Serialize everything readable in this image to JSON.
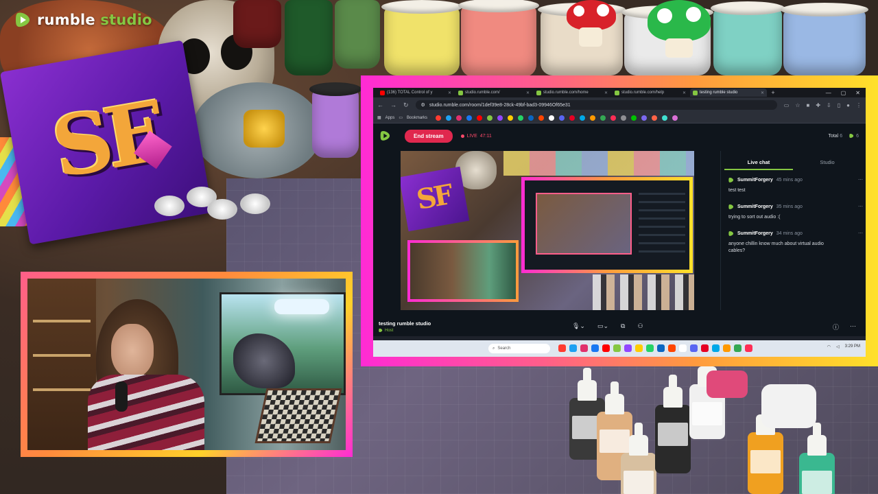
{
  "brand": {
    "name_main": "rumble",
    "name_accent": " studio",
    "accent_color": "#85c742"
  },
  "background": {
    "sf_letters": "SF"
  },
  "browser": {
    "tabs": [
      {
        "label": "(136) TOTAL Control of y",
        "favicon_color": "#ff0000"
      },
      {
        "label": "studio.rumble.com/",
        "favicon_color": "#85c742"
      },
      {
        "label": "studio.rumble.com/home",
        "favicon_color": "#85c742"
      },
      {
        "label": "studio.rumble.com/help",
        "favicon_color": "#85c742"
      },
      {
        "label": "testing rumble studio",
        "favicon_color": "#85c742"
      }
    ],
    "new_tab": "+",
    "url": "studio.rumble.com/room/1def39e8-28ck-49bf-bad3-09946Of65e31",
    "bookmarks_label": "Bookmarks",
    "apps_label": "Apps",
    "bookmark_colors": [
      "#ff3b30",
      "#1da1f2",
      "#e1306c",
      "#1877f2",
      "#ff0000",
      "#85c742",
      "#9146ff",
      "#ffcc00",
      "#25d366",
      "#0a66c2",
      "#ff4500",
      "#ffffff",
      "#5865f2",
      "#e60023",
      "#00a8e8",
      "#ff9900",
      "#34a853",
      "#ff2d55",
      "#8e8e93",
      "#00c300",
      "#7b68ee",
      "#ff6347",
      "#40e0d0",
      "#da70d6"
    ]
  },
  "studio": {
    "end_stream_label": "End stream",
    "live_label": "LIVE",
    "live_time": "47:11",
    "total_label": "Total",
    "total_value": "6",
    "viewers_value": "6",
    "chat_tabs": [
      "Live chat",
      "Studio"
    ],
    "chat": [
      {
        "user": "SummitForgery",
        "time": "45 mins ago",
        "text": "test test"
      },
      {
        "user": "SummitForgery",
        "time": "35 mins ago",
        "text": "trying to sort out audio :("
      },
      {
        "user": "SummitForgery",
        "time": "34 mins ago",
        "text": "anyone chillin know much about virtual audio cables?"
      }
    ],
    "stream_title": "testing rumble studio",
    "role_label": "Host"
  },
  "taskbar": {
    "search_placeholder": "Search",
    "clock": "3:29 PM"
  }
}
